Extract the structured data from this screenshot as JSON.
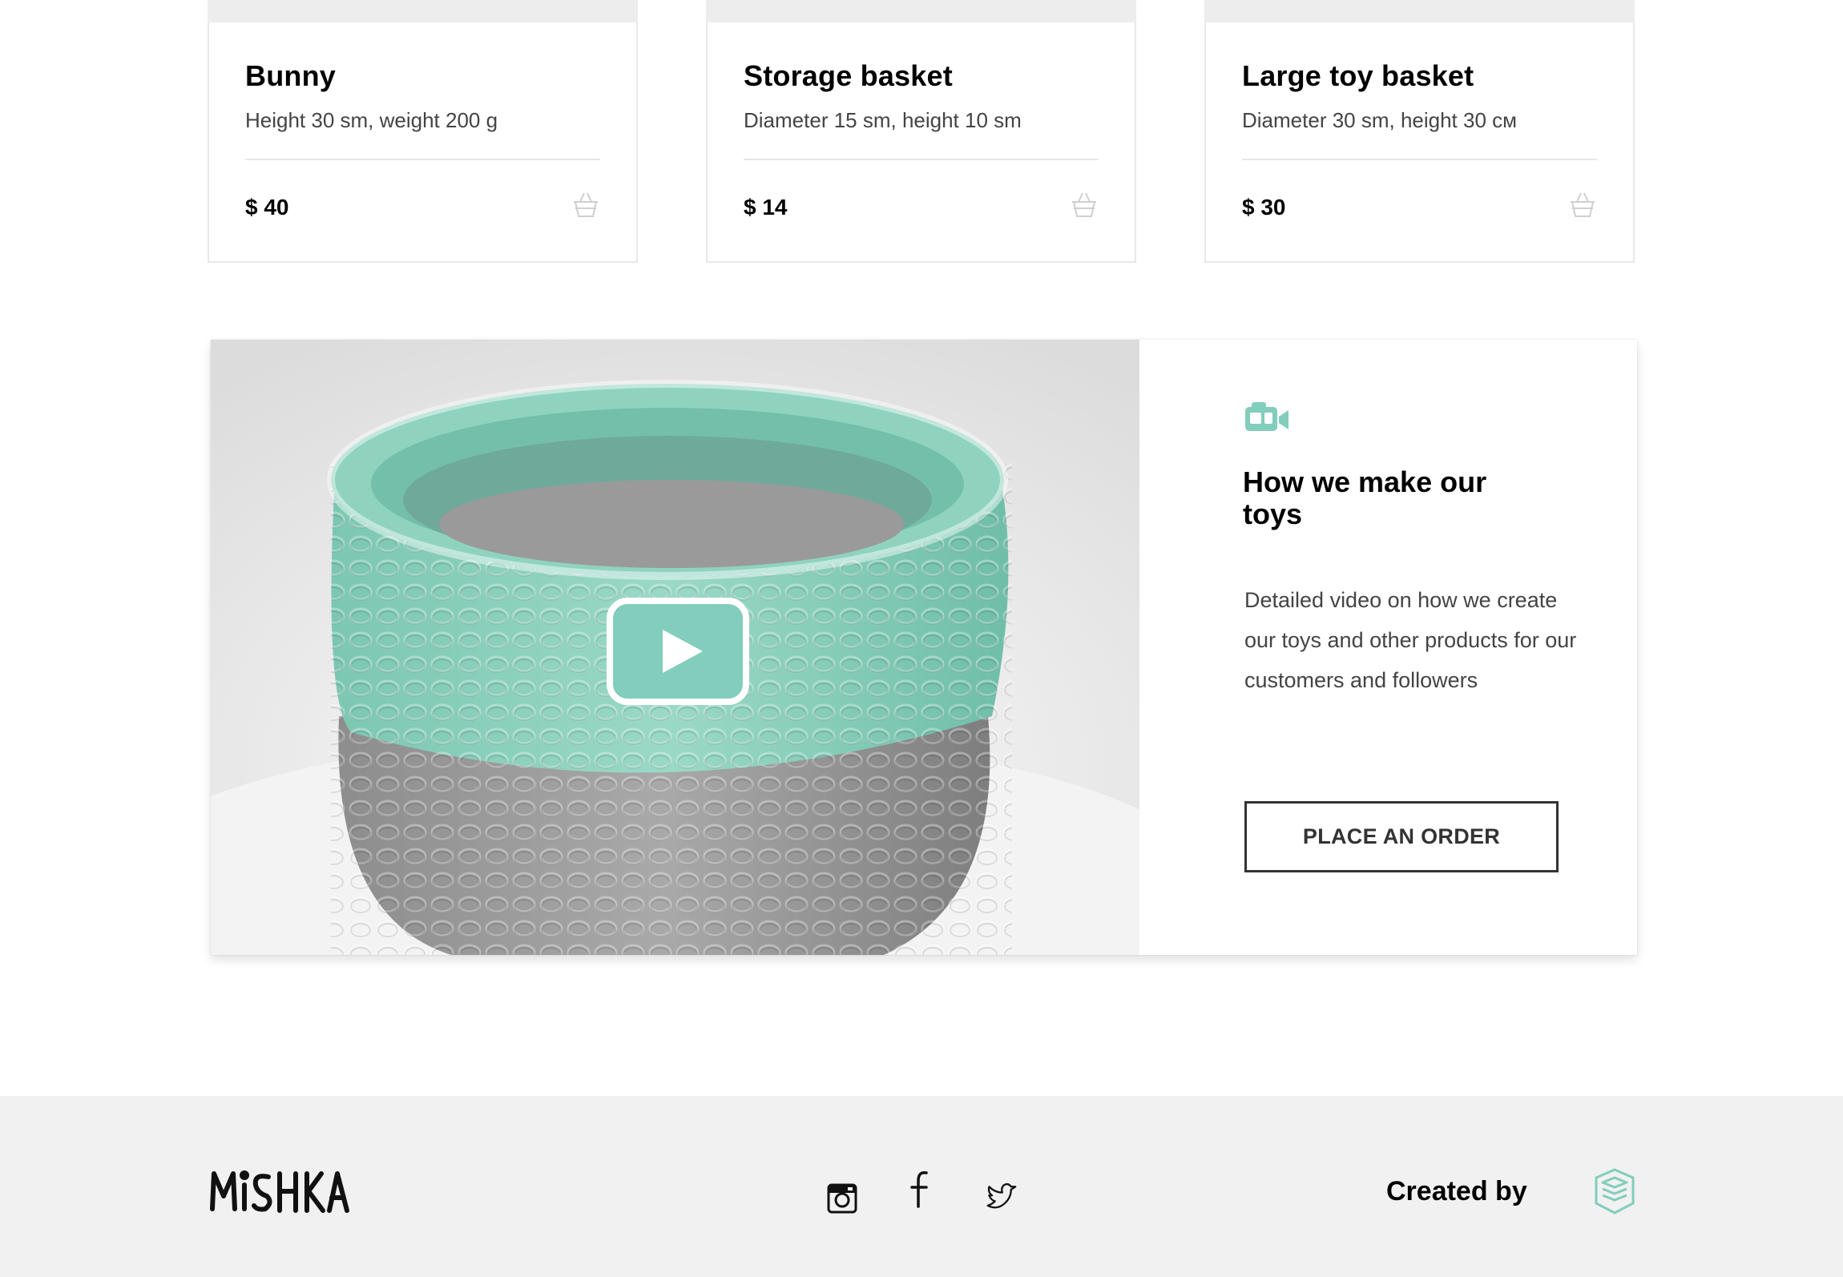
{
  "products": [
    {
      "title": "Bunny",
      "description": "Height 30 sm, weight 200 g",
      "price": "$ 40",
      "cart_icon": "basket-icon"
    },
    {
      "title": "Storage basket",
      "description": "Diameter 15 sm, height 10 sm",
      "price": "$ 14",
      "cart_icon": "basket-icon"
    },
    {
      "title": "Large toy basket",
      "description": "Diameter 30 sm, height 30 см",
      "price": "$ 30",
      "cart_icon": "basket-icon"
    }
  ],
  "video": {
    "icon": "video-camera-icon",
    "title": "How we make our toys",
    "description": "Detailed video on how we create our toys and other products for our customers and followers",
    "order_button": "Place an order",
    "play_icon": "play-icon"
  },
  "footer": {
    "logo": "MiSHKA",
    "social": [
      "instagram-icon",
      "facebook-icon",
      "twitter-icon"
    ],
    "created_by": "Created by",
    "studio_icon": "studio-logo-icon"
  },
  "colors": {
    "accent": "#82cdbc",
    "footer_bg": "#f1f1f1",
    "text": "#000000",
    "muted_text": "#444444",
    "border": "#e8e8e8"
  }
}
